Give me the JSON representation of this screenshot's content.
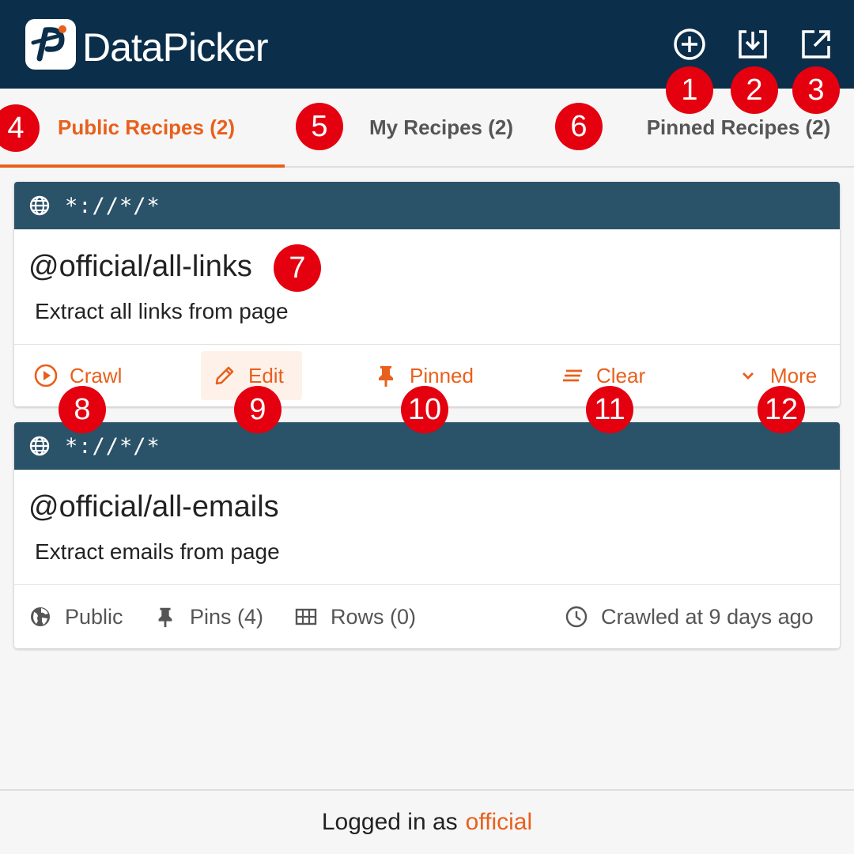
{
  "header": {
    "brand": "DataPicker",
    "buttons": [
      {
        "icon": "add-circle-icon"
      },
      {
        "icon": "download-icon"
      },
      {
        "icon": "open-external-icon"
      }
    ]
  },
  "tabs": [
    {
      "label": "Public Recipes (2)",
      "active": true
    },
    {
      "label": "My Recipes (2)",
      "active": false
    },
    {
      "label": "Pinned Recipes (2)",
      "active": false
    }
  ],
  "cards": [
    {
      "url": "*://*/*",
      "title": "@official/all-links",
      "description": "Extract all links from page",
      "actions": {
        "crawl": "Crawl",
        "edit": "Edit",
        "pinned": "Pinned",
        "clear": "Clear",
        "more": "More"
      }
    },
    {
      "url": "*://*/*",
      "title": "@official/all-emails",
      "description": "Extract emails from page",
      "meta": {
        "visibility": "Public",
        "pins": "Pins (4)",
        "rows": "Rows (0)",
        "crawled": "Crawled at 9 days ago"
      }
    }
  ],
  "footer": {
    "prefix": "Logged in as",
    "user": "official"
  },
  "badges": [
    "1",
    "2",
    "3",
    "4",
    "5",
    "6",
    "7",
    "8",
    "9",
    "10",
    "11",
    "12"
  ],
  "colors": {
    "header_bg": "#0b2e4a",
    "card_head_bg": "#2a5268",
    "accent": "#e8601c",
    "badge": "#e4000f"
  }
}
